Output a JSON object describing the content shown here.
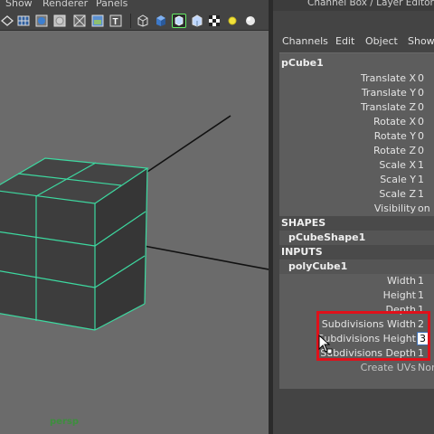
{
  "viewport": {
    "menu": [
      "Show",
      "Renderer",
      "Panels"
    ],
    "camera_label": "persp",
    "toolbar_icons": [
      "wireframe-icon",
      "grid-icon",
      "smooth-shade-icon",
      "shaded-icon",
      "xray-icon",
      "image-plane-icon",
      "texture-icon",
      "cube-wire-icon",
      "cube-shaded-icon",
      "isolate-select-icon",
      "cube-textured-icon",
      "checker-icon",
      "light-icon",
      "sphere-icon"
    ]
  },
  "panel": {
    "title": "Channel Box / Layer Editor",
    "menu": [
      "Channels",
      "Edit",
      "Object",
      "Show"
    ],
    "object_name": "pCube1",
    "channels": [
      {
        "label": "Translate X",
        "value": "0"
      },
      {
        "label": "Translate Y",
        "value": "0"
      },
      {
        "label": "Translate Z",
        "value": "0"
      },
      {
        "label": "Rotate X",
        "value": "0"
      },
      {
        "label": "Rotate Y",
        "value": "0"
      },
      {
        "label": "Rotate Z",
        "value": "0"
      },
      {
        "label": "Scale X",
        "value": "1"
      },
      {
        "label": "Scale Y",
        "value": "1"
      },
      {
        "label": "Scale Z",
        "value": "1"
      },
      {
        "label": "Visibility",
        "value": "on"
      }
    ],
    "shapes_header": "SHAPES",
    "shape_name": "pCubeShape1",
    "inputs_header": "INPUTS",
    "input_name": "polyCube1",
    "input_channels": [
      {
        "label": "Width",
        "value": "1"
      },
      {
        "label": "Height",
        "value": "1"
      },
      {
        "label": "Depth",
        "value": "1"
      },
      {
        "label": "Subdivisions Width",
        "value": "2"
      },
      {
        "label": "Subdivisions Height",
        "value": "3"
      },
      {
        "label": "Subdivisions Depth",
        "value": "1"
      },
      {
        "label": "Create UVs",
        "value": "Nor"
      }
    ]
  },
  "colors": {
    "highlight": "#e0101a",
    "wire": "#3dd9a0",
    "camera_label": "#3d8f3d"
  }
}
